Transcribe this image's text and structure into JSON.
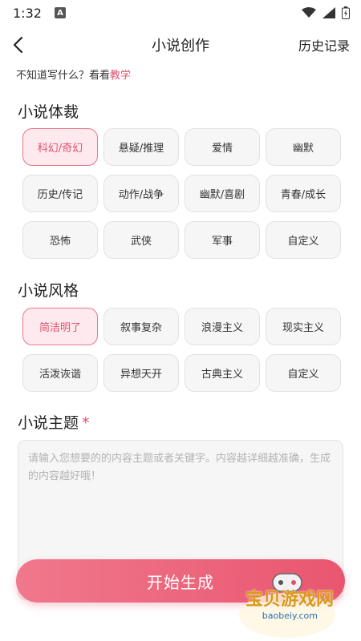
{
  "status_bar": {
    "time": "1:32",
    "notification_letter": "A"
  },
  "header": {
    "title": "小说创作",
    "history_label": "历史记录"
  },
  "hint": {
    "prefix": "不知道写什么？看看",
    "link": "教学"
  },
  "genre": {
    "title": "小说体裁",
    "items": [
      "科幻/奇幻",
      "悬疑/推理",
      "爱情",
      "幽默",
      "历史/传记",
      "动作/战争",
      "幽默/喜剧",
      "青春/成长",
      "恐怖",
      "武侠",
      "军事",
      "自定义"
    ],
    "selected": "科幻/奇幻"
  },
  "style": {
    "title": "小说风格",
    "items": [
      "简洁明了",
      "叙事复杂",
      "浪漫主义",
      "现实主义",
      "活泼诙谐",
      "异想天开",
      "古典主义",
      "自定义"
    ],
    "selected": "简洁明了"
  },
  "topic": {
    "title": "小说主题",
    "required_mark": "*",
    "placeholder": "请输入您想要的的内容主题或者关键字。内容越详细越准确，生成的内容越好哦！"
  },
  "start_button": {
    "label": "开始生成"
  },
  "watermark": {
    "text": "宝贝游戏网",
    "url": "baobeiy.com"
  },
  "colors": {
    "accent": "#e0516b",
    "chip_bg": "#f6f6f6",
    "selected_bg": "#fde9ee"
  }
}
